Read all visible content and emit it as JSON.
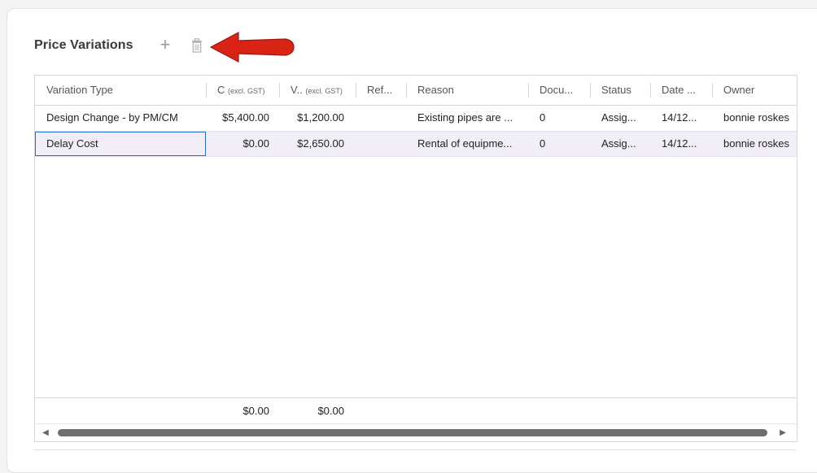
{
  "panel": {
    "title": "Price Variations",
    "add_icon": "plus-icon",
    "delete_icon": "trash-icon",
    "annotation_icon": "red-arrow-icon",
    "annotation_color": "#d92314"
  },
  "grid": {
    "columns": [
      {
        "label": "Variation Type"
      },
      {
        "label": "C",
        "suffix": "(excl. GST)"
      },
      {
        "label": "V..",
        "suffix": "(excl. GST)"
      },
      {
        "label": "Ref..."
      },
      {
        "label": "Reason"
      },
      {
        "label": "Docu..."
      },
      {
        "label": "Status"
      },
      {
        "label": "Date ..."
      },
      {
        "label": "Owner"
      }
    ],
    "rows": [
      [
        "Design Change - by PM/CM",
        "$5,400.00",
        "$1,200.00",
        "",
        "Existing pipes are ...",
        "0",
        "Assig...",
        "14/12...",
        "bonnie roskes"
      ],
      [
        "Delay Cost",
        "$0.00",
        "$2,650.00",
        "",
        "Rental of equipme...",
        "0",
        "Assig...",
        "14/12...",
        "bonnie roskes"
      ]
    ],
    "totals": [
      "$0.00",
      "$0.00"
    ],
    "selected_row_color": "#f1eef7",
    "selection_border_color": "#2a6fd6"
  }
}
